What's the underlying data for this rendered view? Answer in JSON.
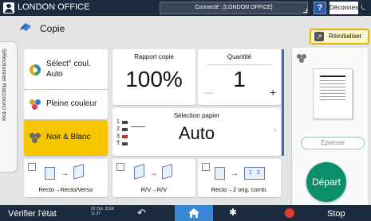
{
  "topbar": {
    "office": "LONDON OFFICE",
    "connection": "Connecté : [LONDON OFFICE]",
    "help": "?",
    "logout": "Déconnexion"
  },
  "header": {
    "title": "Copie",
    "reset": "Réinitialiser"
  },
  "side_tab": "Sélectionner Raccourci trxx",
  "color": {
    "label_line1": "Sélect° coul.",
    "label_line2": "Auto",
    "full": "Pleine couleur",
    "bw": "Noir & Blanc"
  },
  "ratio": {
    "caption": "Rapport copie",
    "value": "100%"
  },
  "quantity": {
    "caption": "Quantité",
    "value": "1",
    "minus": "—",
    "plus": "+"
  },
  "paper": {
    "caption": "Sélection papier",
    "value": "Auto",
    "trays": [
      "1",
      "2",
      "3",
      "T"
    ],
    "chevron": "›"
  },
  "options": [
    {
      "label": "Recto→Recto/Verso"
    },
    {
      "label": "R/V→R/V"
    },
    {
      "label": "Recto→2 orig. comb.",
      "pages": [
        "1",
        "2"
      ]
    }
  ],
  "right_panel": {
    "proof": "Épreuve",
    "start": "Départ"
  },
  "bottom": {
    "check_status": "Vérifier l'état",
    "date_line1": "02 Oct. 2018",
    "date_line2": "11:37",
    "stop": "Stop"
  },
  "colors": {
    "accent_blue": "#2d6fc4",
    "selected_yellow": "#f6c600",
    "start_green": "#0a8f6a",
    "dark_bar": "#1c2a3e"
  }
}
